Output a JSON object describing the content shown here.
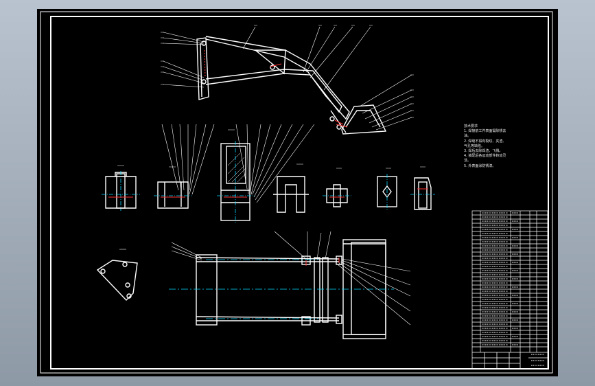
{
  "drawing": {
    "technical_requirements": [
      "技术要求",
      "1. 焊接前工件表面需除锈去油。",
      "2. 焊缝不得有裂纹、夹渣、气孔等缺陷。",
      "3. 焊后去除焊渣、飞溅。",
      "4. 装配后各运动部件转动灵活。",
      "5. 外表面涂防锈漆。"
    ],
    "colors": {
      "background": "#000000",
      "lines": "#ffffff",
      "center_lines": "#00d8ff",
      "hatch": "#ff3030",
      "frame": "#ffffff"
    }
  }
}
